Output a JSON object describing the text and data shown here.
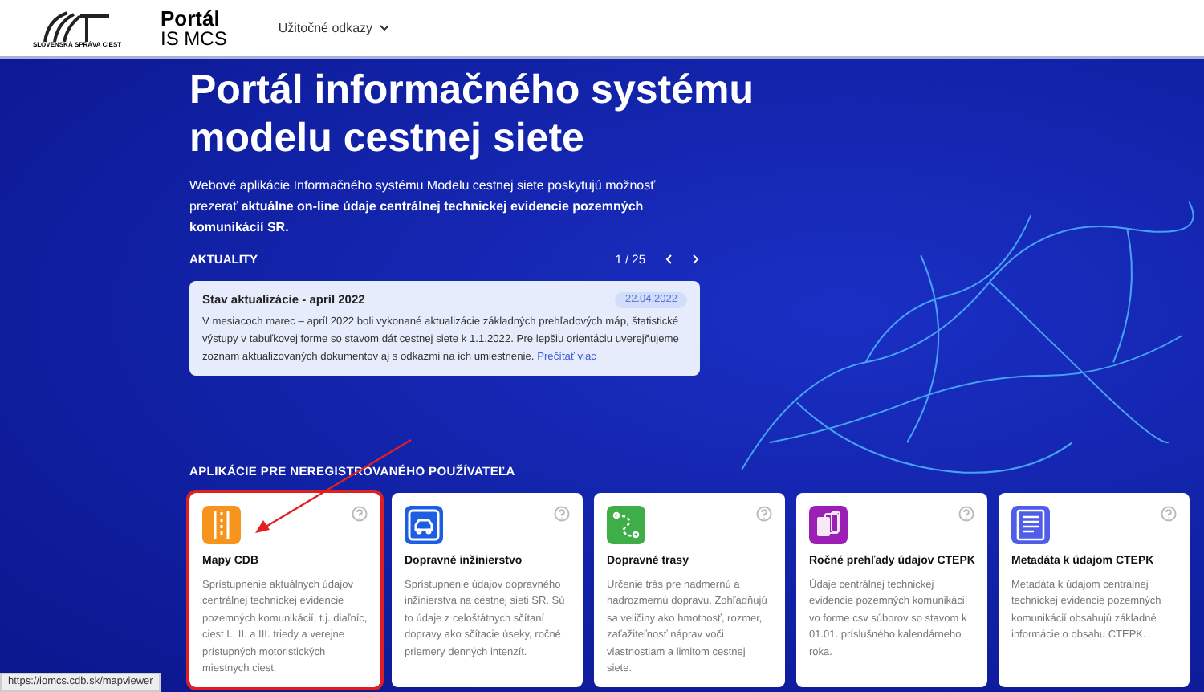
{
  "header": {
    "logo_caption": "SLOVENSKÁ SPRÁVA CIEST",
    "brand_title": "Portál",
    "brand_subtitle": "IS MCS",
    "menu": "Užitočné odkazy"
  },
  "hero": {
    "title": "Portál informačného systému modelu cestnej siete",
    "description": "Webové aplikácie Informačného systému Modelu cestnej siete poskytujú možnosť prezerať **aktuálne on-line údaje centrálnej technickej evidencie pozemných komunikácií SR.**"
  },
  "news": {
    "heading": "AKTUALITY",
    "pager": "1 / 25",
    "item": {
      "title": "Stav aktualizácie - apríl 2022",
      "date": "22.04.2022",
      "text": "V mesiacoch marec – apríl 2022 boli vykonané aktualizácie základných prehľadových máp, štatistické výstupy v tabuľkovej forme so stavom dát cestnej siete k 1.1.2022. Pre lepšiu orientáciu uverejňujeme zoznam aktualizovaných dokumentov aj s odkazmi na ich umiestnenie.",
      "link": "Prečítať viac"
    }
  },
  "apps": {
    "heading": "APLIKÁCIE PRE NEREGISTROVANÉHO POUŽÍVATEĽA",
    "cards": [
      {
        "kind": "road",
        "color": "#f7941d",
        "title": "Mapy CDB",
        "text": "Sprístupnenie aktuálnych údajov centrálnej technickej evidencie pozemných komunikácií, t.j. diaľníc, ciest I., II. a III. triedy a verejne prístupných motoristických miestnych ciest.",
        "highlighted": true
      },
      {
        "kind": "car",
        "color": "#1d5fe0",
        "title": "Dopravné inžinierstvo",
        "text": "Sprístupnenie údajov dopravného inžinierstva na cestnej sieti SR. Sú to údaje z celoštátnych sčítaní dopravy ako sčítacie úseky, ročné priemery denných intenzít.",
        "highlighted": false
      },
      {
        "kind": "route",
        "color": "#3fae49",
        "title": "Dopravné trasy",
        "text": "Určenie trás pre nadmernú a nadrozmernú dopravu. Zohľadňujú sa veličiny ako hmotnosť, rozmer, zaťažiteľnosť náprav voči vlastnostiam a limitom cestnej siete.",
        "highlighted": false
      },
      {
        "kind": "files",
        "color": "#9b1fb5",
        "title": "Ročné prehľady údajov CTEPK",
        "text": "Údaje centrálnej technickej evidencie pozemných komunikácií vo forme csv súborov so stavom k 01.01. príslušného kalendárneho roka.",
        "highlighted": false
      },
      {
        "kind": "document",
        "color": "#4f5de8",
        "title": "Metadáta k údajom CTEPK",
        "text": "Metadáta k údajom centrálnej technickej evidencie pozemných komunikácií obsahujú základné informácie o obsahu CTEPK.",
        "highlighted": false
      }
    ]
  },
  "status_bar": "https://iomcs.cdb.sk/mapviewer"
}
